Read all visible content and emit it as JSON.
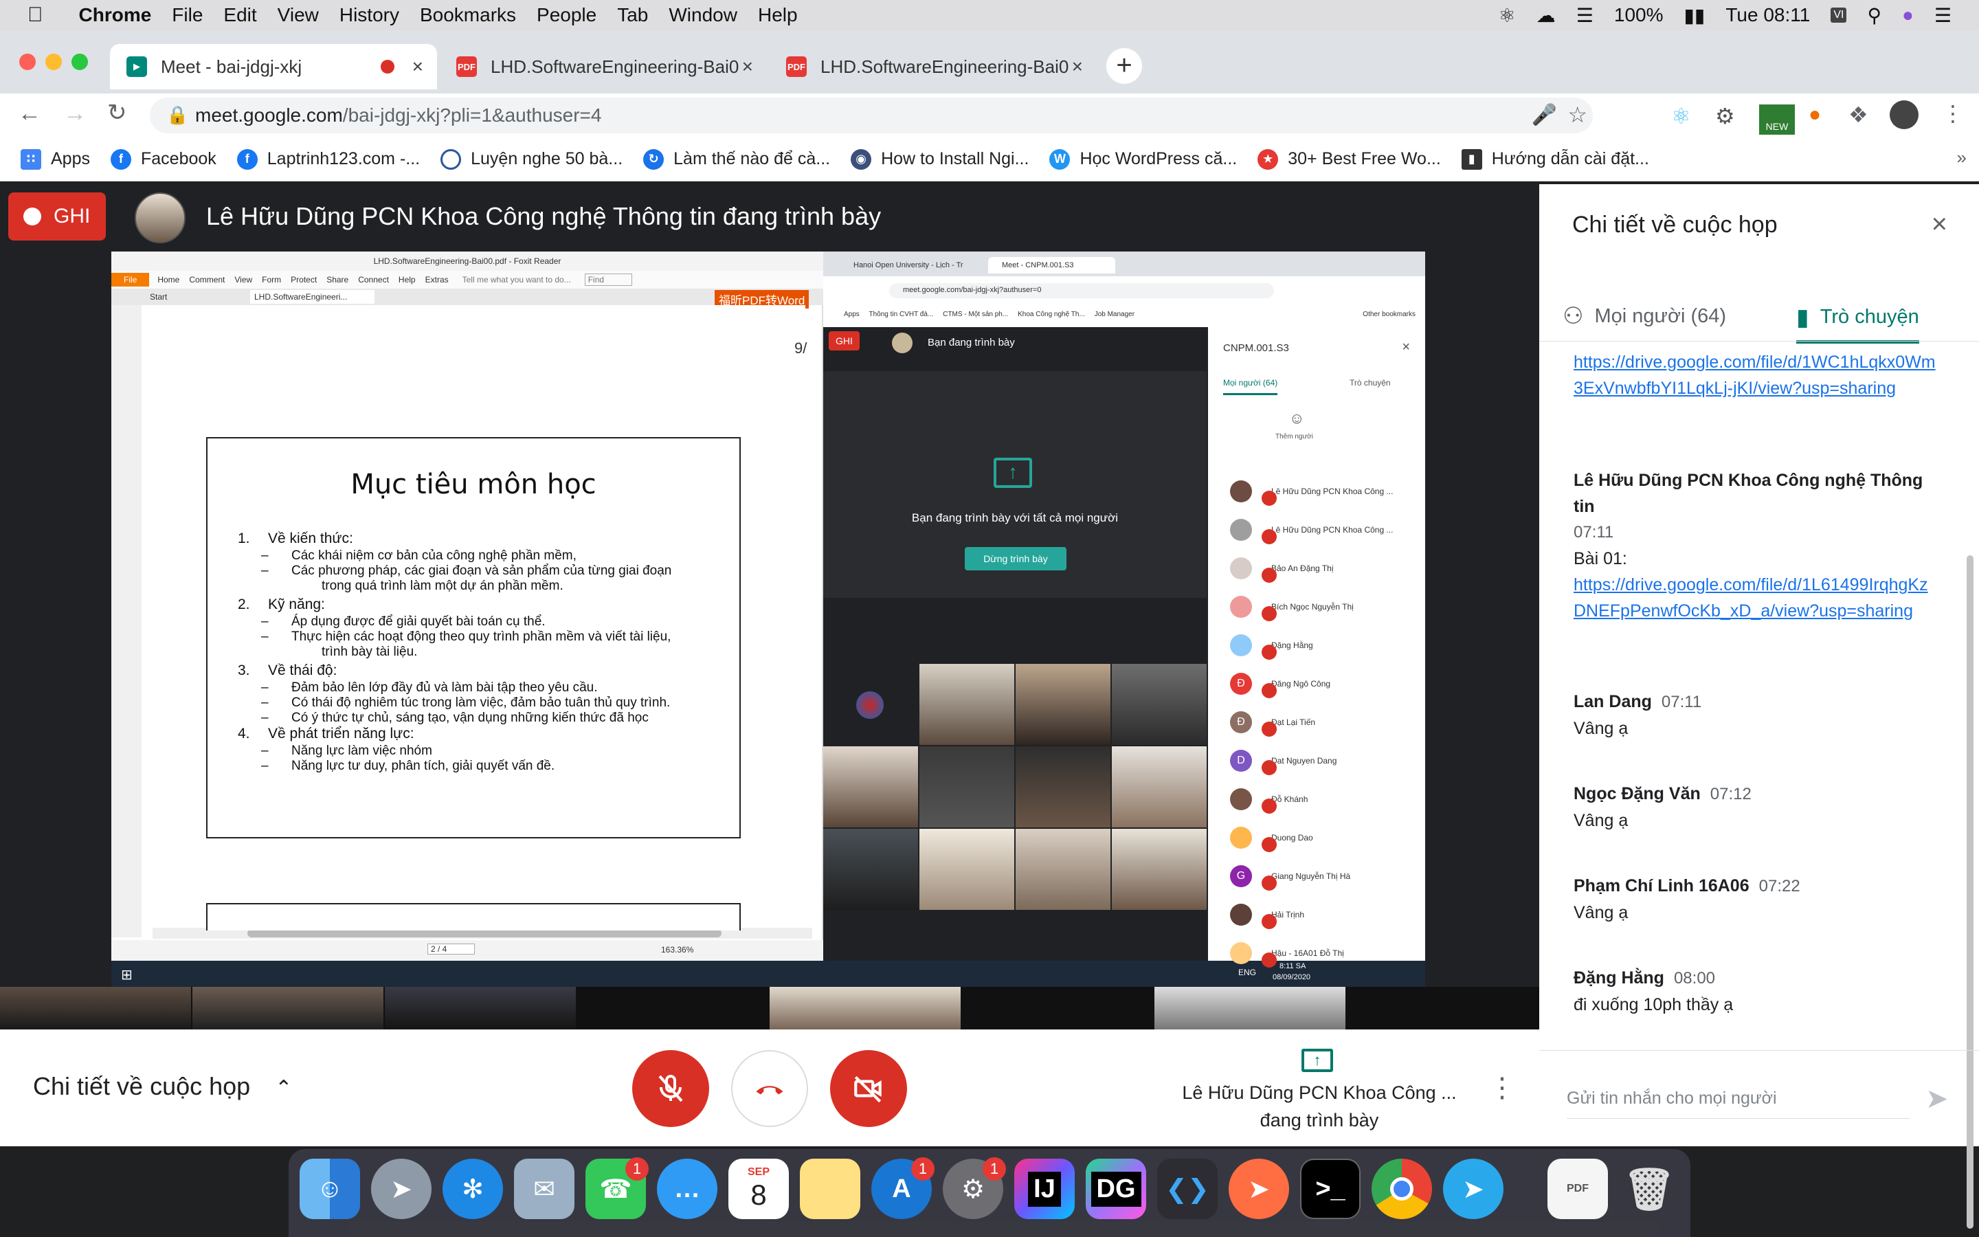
{
  "menubar": {
    "app": "Chrome",
    "items": [
      "File",
      "Edit",
      "View",
      "History",
      "Bookmarks",
      "People",
      "Tab",
      "Window",
      "Help"
    ],
    "battery": "100%",
    "clock": "Tue 08:11"
  },
  "tabs": [
    {
      "title": "Meet - bai-jdgj-xkj",
      "icon": "meet-icon"
    },
    {
      "title": "LHD.SoftwareEngineering-Bai0",
      "icon": "pdf-icon"
    },
    {
      "title": "LHD.SoftwareEngineering-Bai0",
      "icon": "pdf-icon"
    }
  ],
  "omnibox": {
    "host": "meet.google.com",
    "path": "/bai-jdgj-xkj?pli=1&authuser=4"
  },
  "bookmarks": [
    {
      "label": "Apps",
      "color": "#4285f4"
    },
    {
      "label": "Facebook",
      "color": "#1877f2"
    },
    {
      "label": "Laptrinh123.com -...",
      "color": "#1877f2"
    },
    {
      "label": "Luyện nghe 50 bà...",
      "color": "#2b579a"
    },
    {
      "label": "Làm thế nào để cà...",
      "color": "#1a73e8"
    },
    {
      "label": "How to Install Ngi...",
      "color": "#3c4f7a"
    },
    {
      "label": "Học WordPress că...",
      "color": "#2196f3"
    },
    {
      "label": "30+ Best Free Wo...",
      "color": "#e53935"
    },
    {
      "label": "Hướng dẫn cài đặt...",
      "color": "#333333"
    }
  ],
  "meet": {
    "record_label": "GHI",
    "presenter_title": "Lê Hữu Dũng PCN Khoa Công nghệ Thông tin đang trình bày",
    "details_label": "Chi tiết về cuộc họp",
    "presenting_line1": "Lê Hữu Dũng PCN Khoa Công ...",
    "presenting_line2": "đang trình bày"
  },
  "panel": {
    "title": "Chi tiết về cuộc họp",
    "tab_people": "Mọi người (64)",
    "tab_chat": "Trò chuyện",
    "input_placeholder": "Gửi tin nhắn cho mọi người",
    "messages": [
      {
        "link": "https://drive.google.com/file/d/1WC1hLqkx0Wm3ExVnwbfbYI1LqkLj-jKI/view?usp=sharing"
      },
      {
        "name": "Lê Hữu Dũng PCN Khoa Công nghệ Thông tin",
        "time": "07:11",
        "text": "Bài 01:",
        "link": "https://drive.google.com/file/d/1L61499IrqhgKzDNEFpPenwfOcKb_xD_a/view?usp=sharing"
      },
      {
        "name": "Lan Dang",
        "time": "07:11",
        "text": "Vâng ạ"
      },
      {
        "name": "Ngọc Đặng Văn",
        "time": "07:12",
        "text": "Vâng ạ"
      },
      {
        "name": "Phạm Chí Linh 16A06",
        "time": "07:22",
        "text": "Vâng ạ"
      },
      {
        "name": "Đặng Hằng",
        "time": "08:00",
        "text": "đi xuống 10ph thầy ạ"
      }
    ]
  },
  "foxit": {
    "title": "LHD.SoftwareEngineering-Bai00.pdf - Foxit Reader",
    "ribbon": [
      "File",
      "Home",
      "Comment",
      "View",
      "Form",
      "Protect",
      "Share",
      "Connect",
      "Help",
      "Extras"
    ],
    "tellme": "Tell me what you want to do...",
    "find": "Find",
    "tabs": [
      "Start",
      "LHD.SoftwareEngineeri..."
    ],
    "badge": "福昕PDF转Word",
    "page_num": "9/",
    "page_field": "2 / 4",
    "zoom": "163.36%"
  },
  "slide": {
    "title": "Mục tiêu môn học",
    "lines": [
      {
        "indent": 0,
        "num": "1.",
        "text": "Về kiến thức:"
      },
      {
        "indent": 1,
        "num": "–",
        "text": "Các khái niệm cơ bản của công nghệ phần mềm,"
      },
      {
        "indent": 1,
        "num": "–",
        "text": "Các phương pháp, các giai đoạn và sản phẩm của từng giai đoạn"
      },
      {
        "indent": 2,
        "num": "",
        "text": "trong quá trình làm một dự án phần mềm."
      },
      {
        "indent": 0,
        "num": "2.",
        "text": "Kỹ năng:"
      },
      {
        "indent": 1,
        "num": "–",
        "text": "Áp dụng được để giải quyết bài toán cụ thể."
      },
      {
        "indent": 1,
        "num": "–",
        "text": "Thực hiện các hoạt động theo quy trình phần mềm và viết tài liệu,"
      },
      {
        "indent": 2,
        "num": "",
        "text": "trình bày tài liệu."
      },
      {
        "indent": 0,
        "num": "3.",
        "text": "Về thái độ:"
      },
      {
        "indent": 1,
        "num": "–",
        "text": "Đảm bảo lên lớp đầy đủ và làm bài tập theo yêu cầu."
      },
      {
        "indent": 1,
        "num": "–",
        "text": "Có thái độ nghiêm túc trong làm việc, đảm bảo tuân thủ quy trình."
      },
      {
        "indent": 1,
        "num": "–",
        "text": "Có ý thức tự chủ, sáng tạo, vận dụng những kiến thức đã học"
      },
      {
        "indent": 0,
        "num": "4.",
        "text": "Về phát triển năng lực:"
      },
      {
        "indent": 1,
        "num": "–",
        "text": "Năng lực làm việc nhóm"
      },
      {
        "indent": 1,
        "num": "–",
        "text": "Năng lực tư duy, phân tích, giải quyết vấn đề."
      }
    ]
  },
  "inner_meet": {
    "tab1": "Hanoi Open University - Lịch - Tr",
    "tab2": "Meet - CNPM.001.S3",
    "url": "meet.google.com/bai-jdgj-xkj?authuser=0",
    "bookmarks": [
      "Apps",
      "Thông tin CVHT đà...",
      "CTMS - Một sản ph...",
      "Khoa Công nghệ Th...",
      "Job Manager",
      "Other bookmarks"
    ],
    "record": "GHI",
    "presenting": "Bạn đang trình bày",
    "presenting_all": "Bạn đang trình bày với tất cả mọi người",
    "stop_btn": "Dừng trình bày",
    "meeting_code": "CNPM.001.S3",
    "tab_people": "Mọi người (64)",
    "tab_chat": "Trò chuyện",
    "add_people": "Thêm người",
    "participants": [
      {
        "name": "Lê Hữu Dũng PCN Khoa Công ...",
        "color": "#6d4c41"
      },
      {
        "name": "Lê Hữu Dũng PCN Khoa Công ...",
        "color": "#9e9e9e"
      },
      {
        "name": "Bảo An Đặng Thị",
        "color": "#d7ccc8"
      },
      {
        "name": "Bích Ngọc Nguyễn Thị",
        "color": "#ef9a9a"
      },
      {
        "name": "Đặng Hằng",
        "color": "#90caf9"
      },
      {
        "name": "Đăng Ngô Công",
        "color": "#e53935",
        "initial": "Đ"
      },
      {
        "name": "Đạt Lại Tiến",
        "color": "#8d6e63",
        "initial": "Đ"
      },
      {
        "name": "Dat Nguyen Dang",
        "color": "#7e57c2",
        "initial": "D"
      },
      {
        "name": "Đỗ Khánh",
        "color": "#795548"
      },
      {
        "name": "Duong Dao",
        "color": "#ffb74d"
      },
      {
        "name": "Giang Nguyễn Thị Hà",
        "color": "#8e24aa",
        "initial": "G"
      },
      {
        "name": "Hải Trịnh",
        "color": "#5d4037"
      },
      {
        "name": "Hậu - 16A01 Đỗ Thị",
        "color": "#ffcc80"
      }
    ],
    "taskbar_time": "8:11 SA",
    "taskbar_date": "08/09/2020",
    "taskbar_lang": "ENG"
  },
  "dock": {
    "calendar_month": "SEP",
    "calendar_day": "8",
    "facetime_badge": "1",
    "appstore_badge": "1",
    "prefs_badge": "1",
    "intellij": "IJ",
    "datagrip": "DG"
  }
}
